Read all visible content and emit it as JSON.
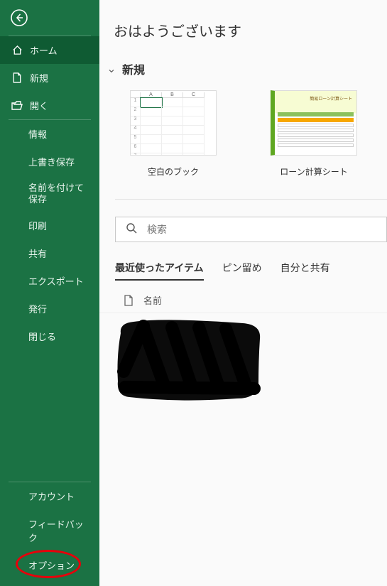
{
  "sidebar": {
    "primary": [
      {
        "label": "ホーム",
        "icon": "home-icon"
      },
      {
        "label": "新規",
        "icon": "new-icon"
      },
      {
        "label": "開く",
        "icon": "open-icon"
      }
    ],
    "secondary": [
      {
        "label": "情報"
      },
      {
        "label": "上書き保存"
      },
      {
        "label": "名前を付けて保存"
      },
      {
        "label": "印刷"
      },
      {
        "label": "共有"
      },
      {
        "label": "エクスポート"
      },
      {
        "label": "発行"
      },
      {
        "label": "閉じる"
      }
    ],
    "bottom": [
      {
        "label": "アカウント"
      },
      {
        "label": "フィードバック"
      },
      {
        "label": "オプション"
      }
    ]
  },
  "main": {
    "greeting": "おはようございます",
    "new_section": "新規",
    "templates": [
      {
        "label": "空白のブック"
      },
      {
        "label": "ローン計算シート"
      }
    ],
    "search_placeholder": "検索",
    "tabs": [
      {
        "label": "最近使ったアイテム"
      },
      {
        "label": "ピン留め"
      },
      {
        "label": "自分と共有"
      }
    ],
    "list_header": "名前"
  }
}
